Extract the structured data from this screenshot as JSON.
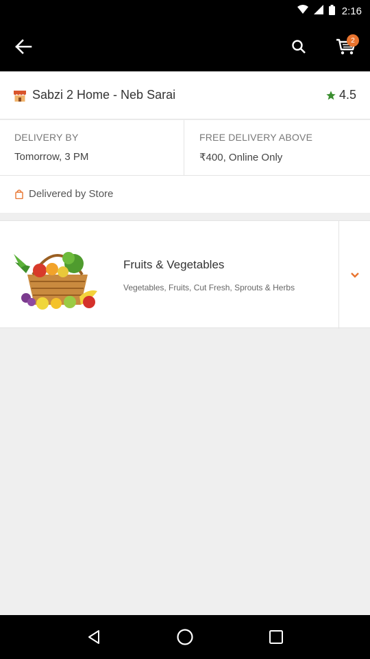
{
  "status_bar": {
    "time": "2:16",
    "icons": [
      "wifi-icon",
      "cellular-icon",
      "battery-icon"
    ]
  },
  "app_bar": {
    "back_icon": "arrow-left-icon",
    "search_icon": "search-icon",
    "cart_icon": "cart-icon",
    "cart_count": "2"
  },
  "store": {
    "icon": "storefront-icon",
    "name": "Sabzi 2 Home - Neb Sarai",
    "rating": "4.5",
    "rating_icon": "star-icon"
  },
  "delivery": {
    "by_label": "DELIVERY BY",
    "by_value": "Tomorrow, 3 PM",
    "free_label": "FREE DELIVERY ABOVE",
    "free_value": "₹400, Online Only"
  },
  "delivered_by": {
    "icon": "shopping-bag-icon",
    "text": "Delivered by Store"
  },
  "category": {
    "image": "fruit-basket-image",
    "title": "Fruits & Vegetables",
    "subtitle": "Vegetables, Fruits, Cut Fresh, Sprouts & Herbs",
    "expand_icon": "chevron-down-icon"
  },
  "colors": {
    "accent": "#e8742f",
    "rating_star": "#3a8e2f",
    "toolbar": "#000000",
    "background": "#efefef"
  },
  "nav": {
    "icons": [
      "back-triangle-icon",
      "home-circle-icon",
      "recents-square-icon"
    ]
  }
}
